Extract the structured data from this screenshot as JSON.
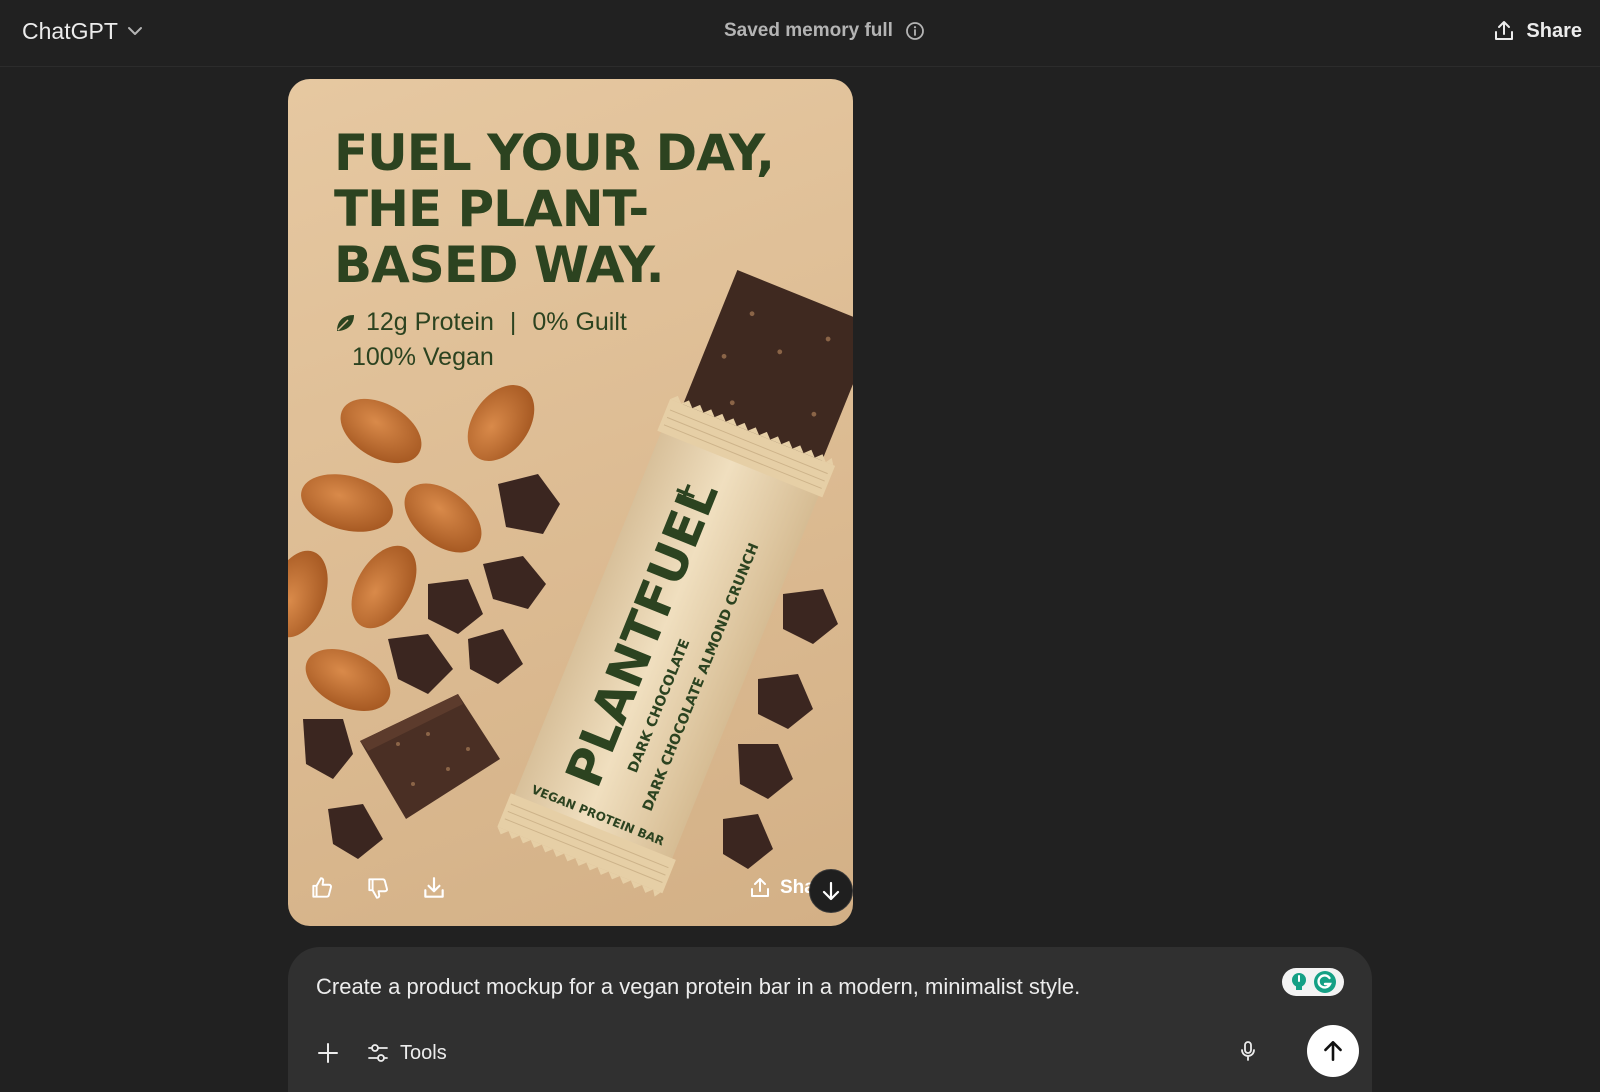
{
  "header": {
    "app_name": "ChatGPT",
    "memory_status": "Saved memory full",
    "share_label": "Share"
  },
  "generated_image": {
    "headline_lines": [
      "FUEL YOUR DAY,",
      "THE PLANT-",
      "BASED WAY."
    ],
    "claim_protein": "12g Protein",
    "claim_separator": "|",
    "claim_guilt": "0% Guilt",
    "claim_vegan": "100% Vegan",
    "brand": "PLANTFUEL",
    "brand_mark": "+",
    "flavor_line1": "DARK CHOCOLATE",
    "flavor_line2": "DARK CHOCOLATE ALMOND CRUNCH",
    "wrapper_footer": "VEGAN PROTEIN BAR",
    "share_label": "Sha",
    "colors": {
      "background": "#dcbb92",
      "headline": "#2c4320",
      "wrapper": "#e9d5b2"
    }
  },
  "composer": {
    "prompt_text": "Create a product mockup for a vegan protein bar in a modern, minimalist style.",
    "tools_label": "Tools"
  },
  "icons": [
    "chevron-down-icon",
    "info-icon",
    "share-icon",
    "thumbs-up-icon",
    "thumbs-down-icon",
    "download-icon",
    "arrow-down-icon",
    "plus-icon",
    "sliders-icon",
    "microphone-icon",
    "arrow-up-icon",
    "grammarly-icon"
  ]
}
